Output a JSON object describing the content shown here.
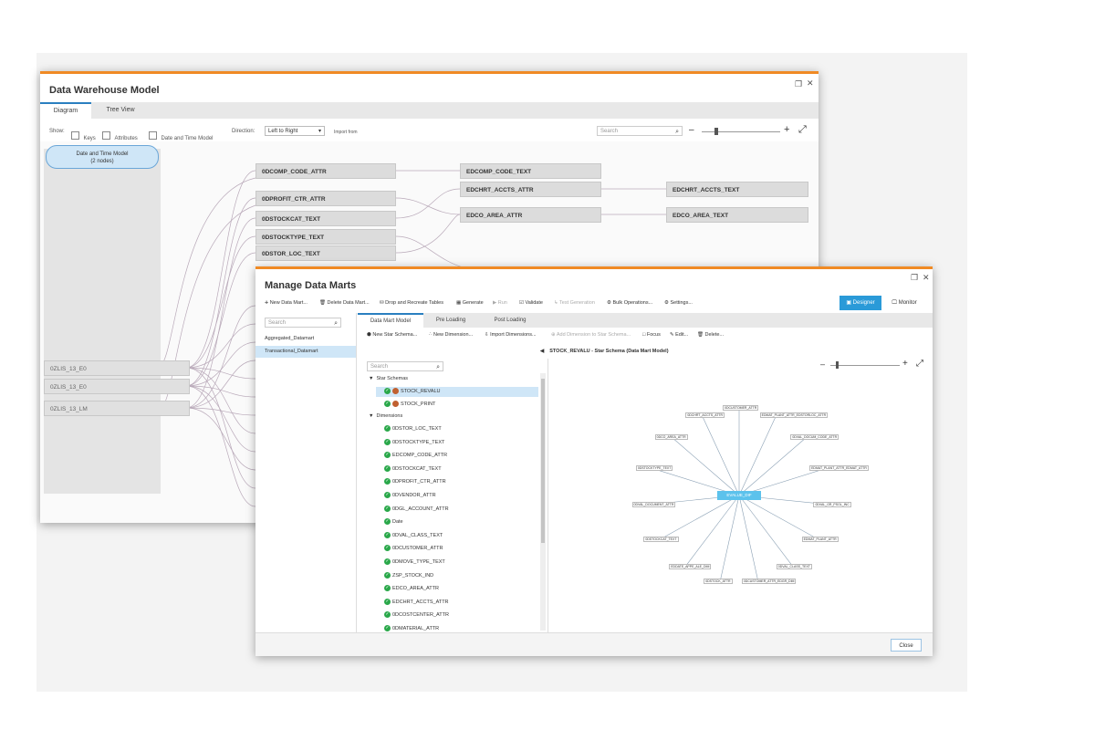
{
  "dw": {
    "title": "Data Warehouse Model",
    "tabs": [
      "Diagram",
      "Tree View"
    ],
    "show_label": "Show:",
    "checkboxes": [
      "Keys",
      "Attributes",
      "Date and Time Model"
    ],
    "direction_label": "Direction:",
    "direction_value": "Left to Right",
    "import_from": "Import from",
    "search_placeholder": "Search",
    "group_node": "Date and Time Model\n(2 nodes)",
    "left_nodes": [
      "0ZLIS_13_E0",
      "0ZLIS_13_E0",
      "0ZLIS_13_LM"
    ],
    "col1_nodes": [
      "0DCOMP_CODE_ATTR",
      "0DPROFIT_CTR_ATTR",
      "0DSTOCKCAT_TEXT",
      "0DSTOCKTYPE_TEXT",
      "0DSTOR_LOC_TEXT"
    ],
    "col2_nodes": [
      "EDCOMP_CODE_TEXT",
      "EDCHRT_ACCTS_ATTR",
      "EDCO_AREA_ATTR"
    ],
    "col3_nodes": [
      "EDCHRT_ACCTS_TEXT",
      "EDCO_AREA_TEXT"
    ]
  },
  "mdm": {
    "title": "Manage Data Marts",
    "toolbar": [
      "New Data Mart...",
      "Delete Data Mart...",
      "Drop and Recreate Tables",
      "Generate",
      "Run",
      "Validate",
      "Test Generation",
      "Bulk Operations...",
      "Settings..."
    ],
    "toolbar_disabled": [
      false,
      false,
      false,
      false,
      true,
      false,
      true,
      false,
      false
    ],
    "designer": "Designer",
    "monitor": "Monitor",
    "search_placeholder": "Search",
    "datamarts": [
      "Aggregated_Datamart",
      "Transactional_Datamart"
    ],
    "tabs": [
      "Data Mart Model",
      "Pre Loading",
      "Post Loading"
    ],
    "subtoolbar": [
      "New Star Schema...",
      "New Dimension...",
      "Import Dimensions...",
      "Add Dimension to Star Schema...",
      "Focus",
      "Edit...",
      "Delete..."
    ],
    "subtoolbar_disabled": [
      false,
      false,
      false,
      true,
      false,
      false,
      false
    ],
    "breadcrumb": "STOCK_REVALU - Star Schema (Data Mart Model)",
    "tree_search": "Search",
    "star_schemas_label": "Star Schemas",
    "star_schemas": [
      "STOCK_REVALU",
      "STOCK_PRINT"
    ],
    "dimensions_label": "Dimensions",
    "dimensions": [
      "0DSTOR_LOC_TEXT",
      "0DSTOCKTYPE_TEXT",
      "EDCOMP_CODE_ATTR",
      "0DSTOCKCAT_TEXT",
      "0DPROFIT_CTR_ATTR",
      "0DVENDOR_ATTR",
      "0DGL_ACCOUNT_ATTR",
      "Date",
      "0DVAL_CLASS_TEXT",
      "0DCUSTOMER_ATTR",
      "0DMOVE_TYPE_TEXT",
      "ZSP_STOCK_IND",
      "EDCO_AREA_ATTR",
      "EDCHRT_ACCTS_ATTR",
      "0DCOSTCENTER_ATTR",
      "0DMATERIAL_ATTR"
    ],
    "center_node": "EVALUE_DIF",
    "star_nodes": [
      "0DCUSTOMER_ATTR",
      "EDMAT_PLANT_ATTR_EDSTORLOC_ATTR",
      "0DVAL_DOCUM_CODE_ATTR",
      "EDMAT_PLANT_ATTR_EDMAT_ATTR",
      "0DVAL_GR_PSOL_INC",
      "EDMAT_PLANT_ATTR",
      "0DVAL_CLASS_TEXT",
      "0DCUSTOMER_ATTR_EDGR_DIM",
      "0DSTOCK_ATTR",
      "EDDATE_APPE_ALE_DIM",
      "0DSTOCKCAT_TEXT",
      "0DVAL_DOCUMENT_ATTR",
      "0DSTOCKTYPE_TEXT",
      "0DCO_AREA_ATTR",
      "0DCHRT_ACCTS_ATTR"
    ],
    "close": "Close"
  },
  "colors": {
    "accent": "#f08a24",
    "selected": "#cfe6f7",
    "active_btn": "#2a9ad8",
    "ok": "#2aa84a"
  }
}
